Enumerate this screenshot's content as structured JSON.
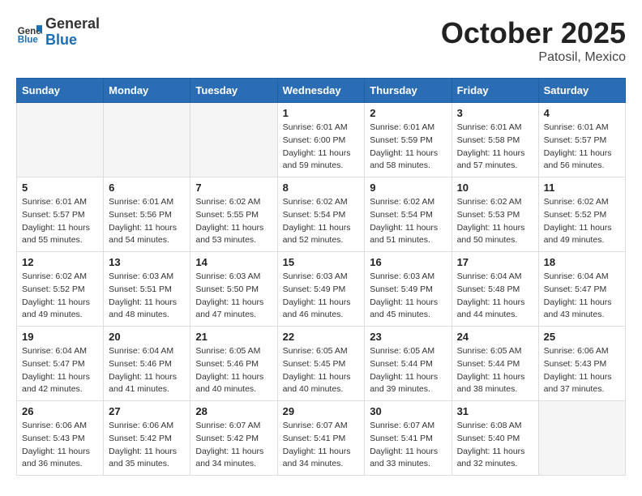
{
  "header": {
    "logo_general": "General",
    "logo_blue": "Blue",
    "month_title": "October 2025",
    "location": "Patosil, Mexico"
  },
  "weekdays": [
    "Sunday",
    "Monday",
    "Tuesday",
    "Wednesday",
    "Thursday",
    "Friday",
    "Saturday"
  ],
  "weeks": [
    [
      {
        "day": "",
        "info": ""
      },
      {
        "day": "",
        "info": ""
      },
      {
        "day": "",
        "info": ""
      },
      {
        "day": "1",
        "info": "Sunrise: 6:01 AM\nSunset: 6:00 PM\nDaylight: 11 hours\nand 59 minutes."
      },
      {
        "day": "2",
        "info": "Sunrise: 6:01 AM\nSunset: 5:59 PM\nDaylight: 11 hours\nand 58 minutes."
      },
      {
        "day": "3",
        "info": "Sunrise: 6:01 AM\nSunset: 5:58 PM\nDaylight: 11 hours\nand 57 minutes."
      },
      {
        "day": "4",
        "info": "Sunrise: 6:01 AM\nSunset: 5:57 PM\nDaylight: 11 hours\nand 56 minutes."
      }
    ],
    [
      {
        "day": "5",
        "info": "Sunrise: 6:01 AM\nSunset: 5:57 PM\nDaylight: 11 hours\nand 55 minutes."
      },
      {
        "day": "6",
        "info": "Sunrise: 6:01 AM\nSunset: 5:56 PM\nDaylight: 11 hours\nand 54 minutes."
      },
      {
        "day": "7",
        "info": "Sunrise: 6:02 AM\nSunset: 5:55 PM\nDaylight: 11 hours\nand 53 minutes."
      },
      {
        "day": "8",
        "info": "Sunrise: 6:02 AM\nSunset: 5:54 PM\nDaylight: 11 hours\nand 52 minutes."
      },
      {
        "day": "9",
        "info": "Sunrise: 6:02 AM\nSunset: 5:54 PM\nDaylight: 11 hours\nand 51 minutes."
      },
      {
        "day": "10",
        "info": "Sunrise: 6:02 AM\nSunset: 5:53 PM\nDaylight: 11 hours\nand 50 minutes."
      },
      {
        "day": "11",
        "info": "Sunrise: 6:02 AM\nSunset: 5:52 PM\nDaylight: 11 hours\nand 49 minutes."
      }
    ],
    [
      {
        "day": "12",
        "info": "Sunrise: 6:02 AM\nSunset: 5:52 PM\nDaylight: 11 hours\nand 49 minutes."
      },
      {
        "day": "13",
        "info": "Sunrise: 6:03 AM\nSunset: 5:51 PM\nDaylight: 11 hours\nand 48 minutes."
      },
      {
        "day": "14",
        "info": "Sunrise: 6:03 AM\nSunset: 5:50 PM\nDaylight: 11 hours\nand 47 minutes."
      },
      {
        "day": "15",
        "info": "Sunrise: 6:03 AM\nSunset: 5:49 PM\nDaylight: 11 hours\nand 46 minutes."
      },
      {
        "day": "16",
        "info": "Sunrise: 6:03 AM\nSunset: 5:49 PM\nDaylight: 11 hours\nand 45 minutes."
      },
      {
        "day": "17",
        "info": "Sunrise: 6:04 AM\nSunset: 5:48 PM\nDaylight: 11 hours\nand 44 minutes."
      },
      {
        "day": "18",
        "info": "Sunrise: 6:04 AM\nSunset: 5:47 PM\nDaylight: 11 hours\nand 43 minutes."
      }
    ],
    [
      {
        "day": "19",
        "info": "Sunrise: 6:04 AM\nSunset: 5:47 PM\nDaylight: 11 hours\nand 42 minutes."
      },
      {
        "day": "20",
        "info": "Sunrise: 6:04 AM\nSunset: 5:46 PM\nDaylight: 11 hours\nand 41 minutes."
      },
      {
        "day": "21",
        "info": "Sunrise: 6:05 AM\nSunset: 5:46 PM\nDaylight: 11 hours\nand 40 minutes."
      },
      {
        "day": "22",
        "info": "Sunrise: 6:05 AM\nSunset: 5:45 PM\nDaylight: 11 hours\nand 40 minutes."
      },
      {
        "day": "23",
        "info": "Sunrise: 6:05 AM\nSunset: 5:44 PM\nDaylight: 11 hours\nand 39 minutes."
      },
      {
        "day": "24",
        "info": "Sunrise: 6:05 AM\nSunset: 5:44 PM\nDaylight: 11 hours\nand 38 minutes."
      },
      {
        "day": "25",
        "info": "Sunrise: 6:06 AM\nSunset: 5:43 PM\nDaylight: 11 hours\nand 37 minutes."
      }
    ],
    [
      {
        "day": "26",
        "info": "Sunrise: 6:06 AM\nSunset: 5:43 PM\nDaylight: 11 hours\nand 36 minutes."
      },
      {
        "day": "27",
        "info": "Sunrise: 6:06 AM\nSunset: 5:42 PM\nDaylight: 11 hours\nand 35 minutes."
      },
      {
        "day": "28",
        "info": "Sunrise: 6:07 AM\nSunset: 5:42 PM\nDaylight: 11 hours\nand 34 minutes."
      },
      {
        "day": "29",
        "info": "Sunrise: 6:07 AM\nSunset: 5:41 PM\nDaylight: 11 hours\nand 34 minutes."
      },
      {
        "day": "30",
        "info": "Sunrise: 6:07 AM\nSunset: 5:41 PM\nDaylight: 11 hours\nand 33 minutes."
      },
      {
        "day": "31",
        "info": "Sunrise: 6:08 AM\nSunset: 5:40 PM\nDaylight: 11 hours\nand 32 minutes."
      },
      {
        "day": "",
        "info": ""
      }
    ]
  ]
}
